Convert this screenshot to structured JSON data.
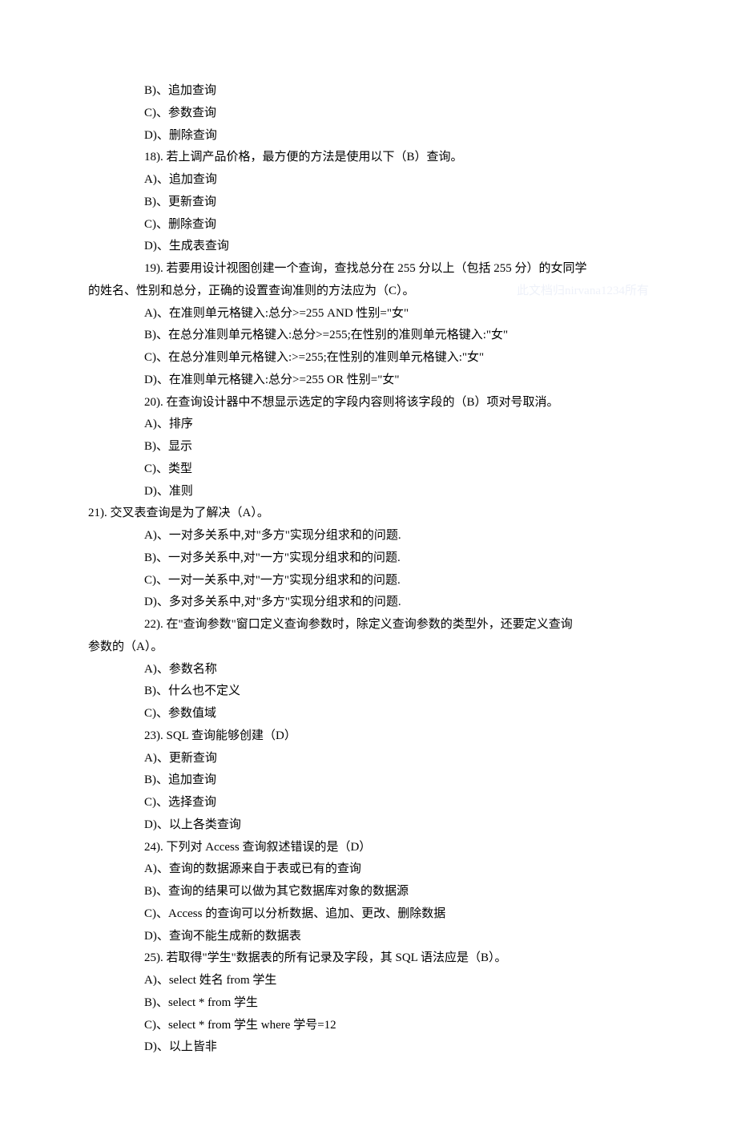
{
  "lines": [
    {
      "cls": "indent1",
      "text": "B)、追加查询"
    },
    {
      "cls": "indent1",
      "text": "C)、参数查询"
    },
    {
      "cls": "indent1",
      "text": "D)、删除查询"
    },
    {
      "cls": "indent1",
      "text": "18). 若上调产品价格，最方便的方法是使用以下（B）查询。"
    },
    {
      "cls": "indent1",
      "text": "A)、追加查询"
    },
    {
      "cls": "indent1",
      "text": "B)、更新查询"
    },
    {
      "cls": "indent1",
      "text": "C)、删除查询"
    },
    {
      "cls": "indent1",
      "text": "D)、生成表查询"
    },
    {
      "cls": "indent1",
      "text": "19). 若要用设计视图创建一个查询，查找总分在 255 分以上（包括 255 分）的女同学"
    },
    {
      "cls": "indent0 watermark-line",
      "text": "的姓名、性别和总分，正确的设置查询准则的方法应为（C）。",
      "wm": true
    },
    {
      "cls": "indent1",
      "text": "A)、在准则单元格键入:总分>=255 AND 性别=\"女\""
    },
    {
      "cls": "indent1",
      "text": "B)、在总分准则单元格键入:总分>=255;在性别的准则单元格键入:\"女\""
    },
    {
      "cls": "indent1",
      "text": "C)、在总分准则单元格键入:>=255;在性别的准则单元格键入:\"女\""
    },
    {
      "cls": "indent1",
      "text": "D)、在准则单元格键入:总分>=255 OR 性别=\"女\""
    },
    {
      "cls": "indent1",
      "text": "20). 在查询设计器中不想显示选定的字段内容则将该字段的（B）项对号取消。"
    },
    {
      "cls": "indent1",
      "text": "A)、排序"
    },
    {
      "cls": "indent1",
      "text": "B)、显示"
    },
    {
      "cls": "indent1",
      "text": "C)、类型"
    },
    {
      "cls": "indent1",
      "text": "D)、准则"
    },
    {
      "cls": "q21",
      "text": "21). 交叉表查询是为了解决（A）。"
    },
    {
      "cls": "indent1",
      "text": "A)、一对多关系中,对\"多方\"实现分组求和的问题."
    },
    {
      "cls": "indent1",
      "text": "B)、一对多关系中,对\"一方\"实现分组求和的问题."
    },
    {
      "cls": "indent1",
      "text": "C)、一对一关系中,对\"一方\"实现分组求和的问题."
    },
    {
      "cls": "indent1",
      "text": "D)、多对多关系中,对\"多方\"实现分组求和的问题."
    },
    {
      "cls": "indent1",
      "text": "22). 在\"查询参数\"窗口定义查询参数时，除定义查询参数的类型外，还要定义查询"
    },
    {
      "cls": "indent0",
      "text": "参数的（A）。"
    },
    {
      "cls": "indent1",
      "text": "A)、参数名称"
    },
    {
      "cls": "indent1",
      "text": "B)、什么也不定义"
    },
    {
      "cls": "indent1",
      "text": "C)、参数值域"
    },
    {
      "cls": "indent1",
      "text": "23). SQL 查询能够创建（D）"
    },
    {
      "cls": "indent1",
      "text": "A)、更新查询"
    },
    {
      "cls": "indent1",
      "text": "B)、追加查询"
    },
    {
      "cls": "indent1",
      "text": "C)、选择查询"
    },
    {
      "cls": "indent1",
      "text": "D)、以上各类查询"
    },
    {
      "cls": "indent1",
      "text": "24). 下列对 Access 查询叙述错误的是（D）"
    },
    {
      "cls": "indent1",
      "text": "A)、查询的数据源来自于表或已有的查询"
    },
    {
      "cls": "indent1",
      "text": "B)、查询的结果可以做为其它数据库对象的数据源"
    },
    {
      "cls": "indent1",
      "text": "C)、Access 的查询可以分析数据、追加、更改、删除数据"
    },
    {
      "cls": "indent1",
      "text": "D)、查询不能生成新的数据表"
    },
    {
      "cls": "indent1",
      "text": "25). 若取得\"学生\"数据表的所有记录及字段，其 SQL 语法应是（B）。"
    },
    {
      "cls": "indent1",
      "text": "A)、select 姓名 from 学生"
    },
    {
      "cls": "indent1",
      "text": "B)、select * from 学生"
    },
    {
      "cls": "indent1",
      "text": "C)、select * from 学生 where 学号=12"
    },
    {
      "cls": "indent1",
      "text": "D)、以上皆非"
    }
  ],
  "watermark": "此文档归nirvana1234所有"
}
